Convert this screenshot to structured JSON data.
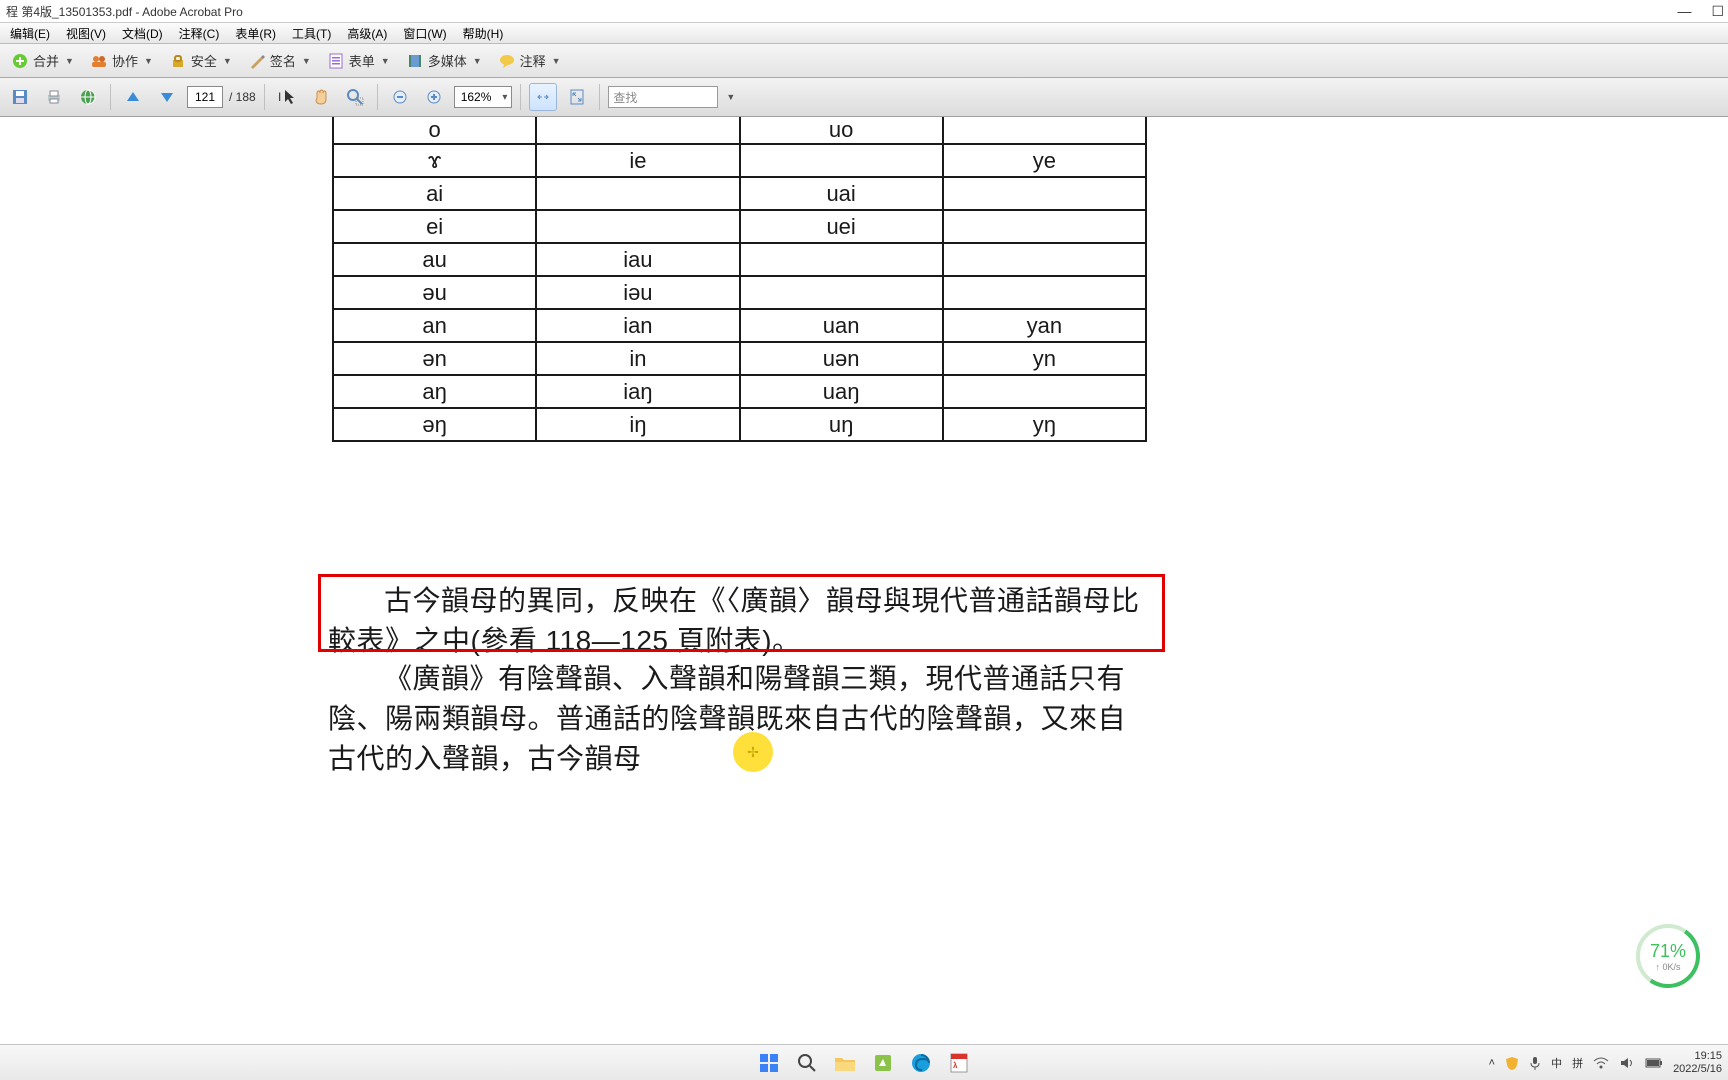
{
  "titlebar": {
    "title": "程 第4版_13501353.pdf - Adobe Acrobat Pro"
  },
  "menubar": {
    "items": [
      "编辑(E)",
      "视图(V)",
      "文档(D)",
      "注释(C)",
      "表单(R)",
      "工具(T)",
      "高级(A)",
      "窗口(W)",
      "帮助(H)"
    ]
  },
  "toolbar1": {
    "merge": "合并",
    "collab": "协作",
    "secure": "安全",
    "sign": "签名",
    "forms": "表单",
    "multimedia": "多媒体",
    "comment": "注释"
  },
  "toolbar2": {
    "page_current": "121",
    "page_total": "/ 188",
    "zoom": "162%",
    "search_placeholder": "查找"
  },
  "chart_data": {
    "type": "table",
    "rows": [
      [
        "o",
        "",
        "uo",
        ""
      ],
      [
        "ɤ",
        "ie",
        "",
        "ye"
      ],
      [
        "ai",
        "",
        "uai",
        ""
      ],
      [
        "ei",
        "",
        "uei",
        ""
      ],
      [
        "au",
        "iau",
        "",
        ""
      ],
      [
        "əu",
        "iəu",
        "",
        ""
      ],
      [
        "an",
        "ian",
        "uan",
        "yan"
      ],
      [
        "ən",
        "in",
        "uən",
        "yn"
      ],
      [
        "aŋ",
        "iaŋ",
        "uaŋ",
        ""
      ],
      [
        "əŋ",
        "iŋ",
        "uŋ",
        "yŋ"
      ]
    ]
  },
  "paragraphs": {
    "p1": "古今韻母的異同，反映在《〈廣韻〉韻母與現代普通話韻母比較表》之中(參看 118—125 頁附表)。",
    "p2": "《廣韻》有陰聲韻、入聲韻和陽聲韻三類，現代普通話只有陰、陽兩類韻母。普通話的陰聲韻既來自古代的陰聲韻，又來自古代的入聲韻，古今韻母"
  },
  "speed": {
    "pct": "71%",
    "rate": "0K/s"
  },
  "tray": {
    "ime1": "中",
    "ime2": "拼",
    "time": "19:15",
    "date": "2022/5/16"
  }
}
